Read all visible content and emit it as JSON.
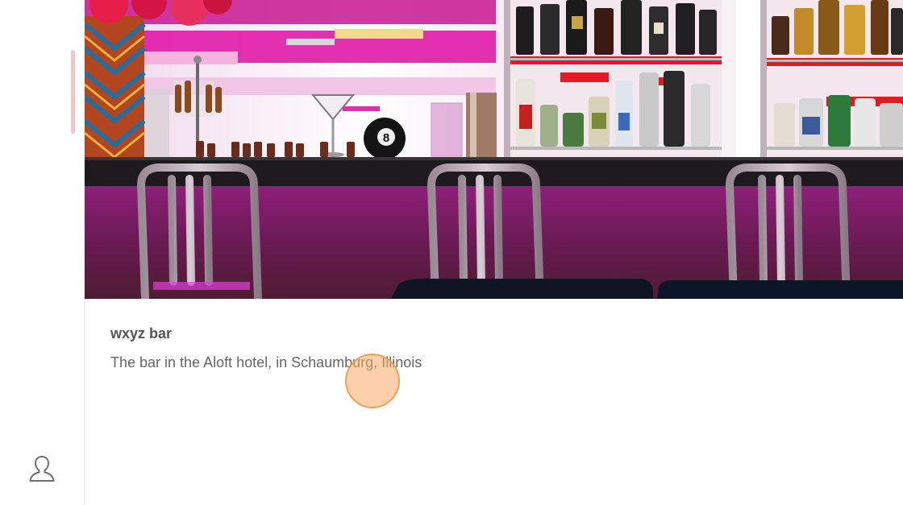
{
  "sidebar": {
    "profile_icon": "user-profile-icon"
  },
  "card": {
    "image_alt": "wxyz bar",
    "title": "wxyz bar",
    "description": "The bar in the Aloft hotel, in Schaumburg, Illinois"
  },
  "colors": {
    "scroll_indicator": "#f6c4cf",
    "click_marker": "#f8aa64",
    "title_text": "#555555",
    "desc_text": "#666666"
  }
}
